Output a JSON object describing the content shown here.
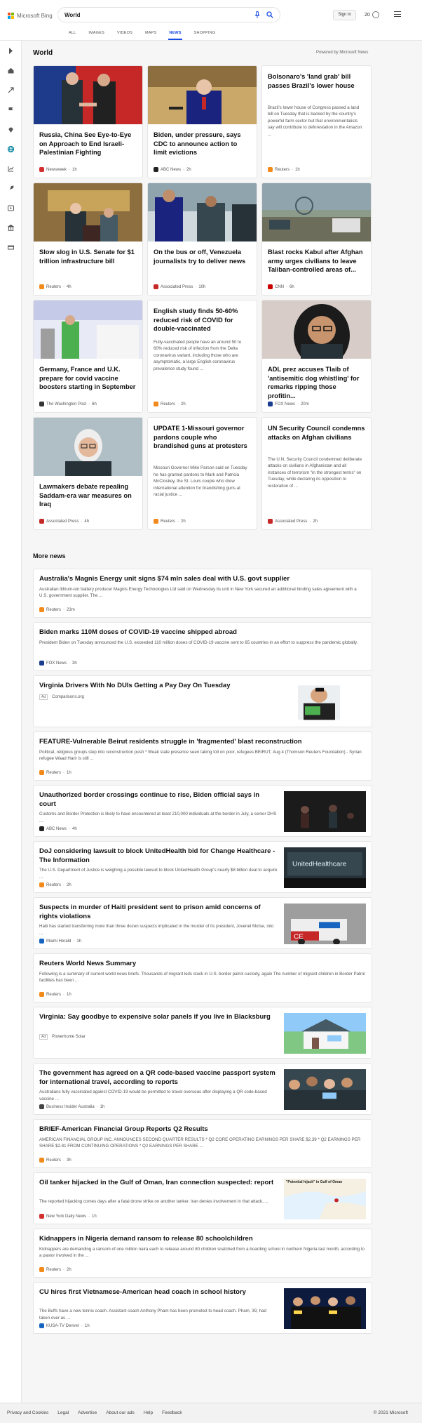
{
  "header": {
    "logo_text": "Microsoft Bing",
    "search_value": "World",
    "sign_in": "Sign in",
    "rewards_count": "20",
    "scopes": [
      "ALL",
      "IMAGES",
      "VIDEOS",
      "MAPS",
      "NEWS",
      "SHOPPING"
    ],
    "active_scope": "NEWS"
  },
  "world": {
    "title": "World",
    "powered_by": "Powered by Microsoft News",
    "cards": [
      {
        "title": "Russia, China See Eye-to-Eye on Approach to End Israeli-Palestinian Fighting",
        "snippet": "",
        "source": "Newsweek",
        "age": "1h",
        "src_color": "#d32f2f"
      },
      {
        "title": "Biden, under pressure, says CDC to announce action to limit evictions",
        "snippet": "",
        "source": "ABC News",
        "age": "2h",
        "src_color": "#222222"
      },
      {
        "title": "Bolsonaro's 'land grab' bill passes Brazil's lower house",
        "snippet": "Brazil's lower house of Congress passed a land bill on Tuesday that is backed by the country's powerful farm sector but that environmentalists say will contribute to deforestation in the Amazon ...",
        "source": "Reuters",
        "age": "1h",
        "src_color": "#f28a1b"
      },
      {
        "title": "Slow slog in U.S. Senate for $1 trillion infrastructure bill",
        "snippet": "",
        "source": "Reuters",
        "age": "4h",
        "src_color": "#f28a1b"
      },
      {
        "title": "On the bus or off, Venezuela journalists try to deliver news",
        "snippet": "",
        "source": "Associated Press",
        "age": "10h",
        "src_color": "#c62828"
      },
      {
        "title": "Blast rocks Kabul after Afghan army urges civilians to leave Taliban-controlled areas of...",
        "snippet": "",
        "source": "CNN",
        "age": "6h",
        "src_color": "#cc0000"
      },
      {
        "title": "Germany, France and U.K. prepare for covid vaccine boosters starting in September",
        "snippet": "",
        "source": "The Washington Post",
        "age": "6h",
        "src_color": "#333333"
      },
      {
        "title": "English study finds 50-60% reduced risk of COVID for double-vaccinated",
        "snippet": "Fully-vaccinated people have an around 50 to 60% reduced risk of infection from the Delta coronavirus variant, including those who are asymptomatic, a large English coronavirus prevalence study found ...",
        "source": "Reuters",
        "age": "2h",
        "src_color": "#f28a1b"
      },
      {
        "title": "ADL prez accuses Tlaib of 'antisemitic dog whistling' for remarks ripping those profitin...",
        "snippet": "",
        "source": "FOX News",
        "age": "20m",
        "src_color": "#1a3d8f"
      },
      {
        "title": "Lawmakers debate repealing Saddam-era war measures on Iraq",
        "snippet": "",
        "source": "Associated Press",
        "age": "4h",
        "src_color": "#c62828"
      },
      {
        "title": "UPDATE 1-Missouri governor pardons couple who brandished guns at protesters",
        "snippet": "Missouri Governor Mike Parson said on Tuesday he has granted pardons to Mark and Patricia McCloskey, the St. Louis couple who drew international attention for brandishing guns at racial justice ...",
        "source": "Reuters",
        "age": "2h",
        "src_color": "#f28a1b"
      },
      {
        "title": "UN Security Council condemns attacks on Afghan civilians",
        "snippet": "The U.N. Security Council condemned deliberate attacks on civilians in Afghanistan and all instances of terrorism \"in the strongest terms\" on Tuesday, while declaring its opposition to restoration of ...",
        "source": "Associated Press",
        "age": "2h",
        "src_color": "#c62828"
      }
    ]
  },
  "more_news": {
    "title": "More news",
    "items": [
      {
        "title": "Australia's Magnis Energy unit signs $74 mln sales deal with U.S. govt supplier",
        "snippet": "Australian lithium-ion battery producer Magnis Energy Technologies Ltd said on Wednesday its unit in New York secured an additional binding sales agreement with a U.S. government supplier. The ...",
        "source": "Reuters",
        "age": "23m",
        "src_color": "#f28a1b",
        "ad": false
      },
      {
        "title": "Biden marks 110M doses of COVID-19 vaccine shipped abroad",
        "snippet": "President Biden on Tuesday announced the U.S. exceeded 110 million doses of COVID-19 vaccine sent to 65 countries in an effort to suppress the pandemic globally.",
        "source": "FOX News",
        "age": "3h",
        "src_color": "#1a3d8f",
        "ad": false
      },
      {
        "title": "Virginia Drivers With No DUIs Getting a Pay Day On Tuesday",
        "snippet": "",
        "source": "Comparisons.org",
        "age": "",
        "src_color": "#999999",
        "ad": true
      },
      {
        "title": "FEATURE-Vulnerable Beirut residents struggle in 'fragmented' blast reconstruction",
        "snippet": "Political, religious groups step into reconstruction push * Weak state presence seen taking toll on poor, refugees BEIRUT, Aug 4 (Thomson Reuters Foundation) - Syrian refugee Waad Harir is still ...",
        "source": "Reuters",
        "age": "1h",
        "src_color": "#f28a1b",
        "ad": false
      },
      {
        "title": "Unauthorized border crossings continue to rise, Biden official says in court",
        "snippet": "Customs and Border Protection is likely to have encountered at least 210,000 individuals at the border in July, a senior DHS ...",
        "source": "ABC News",
        "age": "4h",
        "src_color": "#222222",
        "ad": false
      },
      {
        "title": "DoJ considering lawsuit to block UnitedHealth bid for Change Healthcare - The Information",
        "snippet": "The U.S. Department of Justice is weighing a possible lawsuit to block UnitedHealth Group's nearly $8 billion deal to acquire ...",
        "source": "Reuters",
        "age": "2h",
        "src_color": "#f28a1b",
        "ad": false
      },
      {
        "title": "Suspects in murder of Haiti president sent to prison amid concerns of rights violations",
        "snippet": "Haiti has started transferring more than three dozen suspects implicated in the murder of its president, Jovenel Moïse, into ...",
        "source": "Miami Herald",
        "age": "1h",
        "src_color": "#1565c0",
        "ad": false
      },
      {
        "title": "Reuters World News Summary",
        "snippet": "Following is a summary of current world news briefs. Thousands of migrant kids stuck in U.S. border patrol custody, again The number of migrant children in Border Patrol facilities has been ...",
        "source": "Reuters",
        "age": "1h",
        "src_color": "#f28a1b",
        "ad": false
      },
      {
        "title": "Virginia: Say goodbye to expensive solar panels if you live in Blacksburg",
        "snippet": "",
        "source": "Powerhome Solar",
        "age": "",
        "src_color": "#999999",
        "ad": true
      },
      {
        "title": "The government has agreed on a QR code-based vaccine passport system for international travel, according to reports",
        "snippet": "Australians fully vaccinated against COVID-19 would be permitted to travel overseas after displaying a QR code-based vaccine ...",
        "source": "Business Insider Australia",
        "age": "1h",
        "src_color": "#444444",
        "ad": false
      },
      {
        "title": "BRIEF-American Financial Group Reports Q2 Results",
        "snippet": "AMERICAN FINANCIAL GROUP INC. ANNOUNCES SECOND QUARTER RESULTS * Q2 CORE OPERATING EARNINGS PER SHARE $2.39 * Q2 EARNINGS PER SHARE $2.81 FROM CONTINUING OPERATIONS * Q2 EARNINGS PER SHARE ...",
        "source": "Reuters",
        "age": "3h",
        "src_color": "#f28a1b",
        "ad": false
      },
      {
        "title": "Oil tanker hijacked in the Gulf of Oman, Iran connection suspected: report",
        "snippet": "The reported hijacking comes days after a fatal drone strike on another tanker. Iran denies involvement in that attack, ...",
        "source": "New York Daily News",
        "age": "1h",
        "src_color": "#d32f2f",
        "ad": false
      },
      {
        "title": "Kidnappers in Nigeria demand ransom to release 80 schoolchildren",
        "snippet": "Kidnappers are demanding a ransom of one million naira each to release around 80 children snatched from a boarding school in northern Nigeria last month, according to a pastor involved in the ...",
        "source": "Reuters",
        "age": "2h",
        "src_color": "#f28a1b",
        "ad": false
      },
      {
        "title": "CU hires first Vietnamese-American head coach in school history",
        "snippet": "The Buffs have a new tennis coach. Assistant coach Anthony Pham has been promoted to head coach. Pham, 39, had taken over as ...",
        "source": "KUSA-TV Denver",
        "age": "1h",
        "src_color": "#1565c0",
        "ad": false
      }
    ],
    "map_caption": "\"Potential hijack\" in Gulf of Oman"
  },
  "footer": {
    "links": [
      "Privacy and Cookies",
      "Legal",
      "Advertise",
      "About our ads",
      "Help",
      "Feedback"
    ],
    "copyright": "© 2021 Microsoft"
  },
  "colors": {
    "accent": "#174ae4",
    "brand": "#00809d"
  }
}
